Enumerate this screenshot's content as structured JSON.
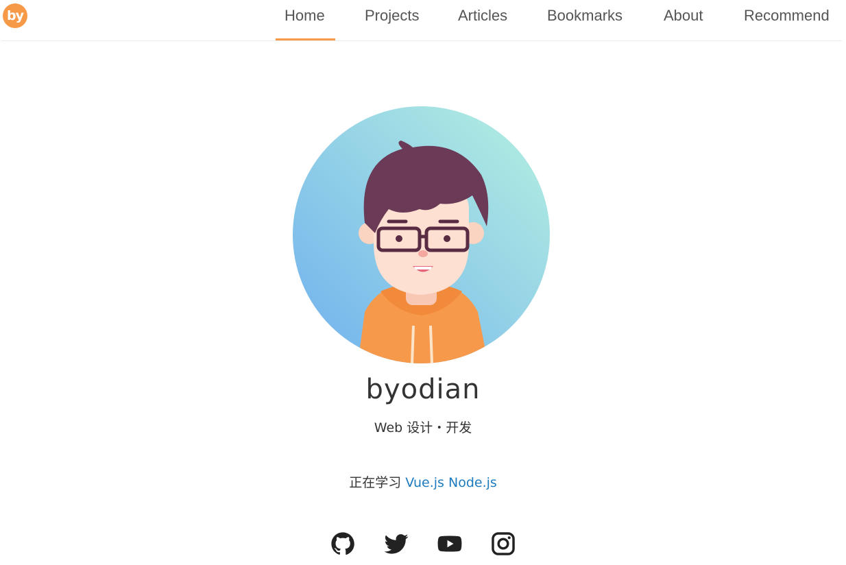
{
  "header": {
    "logo_text": "by",
    "nav": [
      {
        "label": "Home",
        "active": true
      },
      {
        "label": "Projects",
        "active": false
      },
      {
        "label": "Articles",
        "active": false
      },
      {
        "label": "Bookmarks",
        "active": false
      },
      {
        "label": "About",
        "active": false
      },
      {
        "label": "Recommend",
        "active": false
      }
    ]
  },
  "profile": {
    "name": "byodian",
    "tagline": "Web 设计・开发",
    "learning_prefix": "正在学习",
    "learning_links": [
      "Vue.js",
      "Node.js"
    ]
  },
  "socials": [
    {
      "icon": "github-icon"
    },
    {
      "icon": "twitter-icon"
    },
    {
      "icon": "youtube-icon"
    },
    {
      "icon": "instagram-icon"
    }
  ],
  "colors": {
    "accent": "#f79a48",
    "link": "#1d7bbf",
    "avatar_bg_from": "#7cb6ec",
    "avatar_bg_to": "#b4f0e2"
  }
}
